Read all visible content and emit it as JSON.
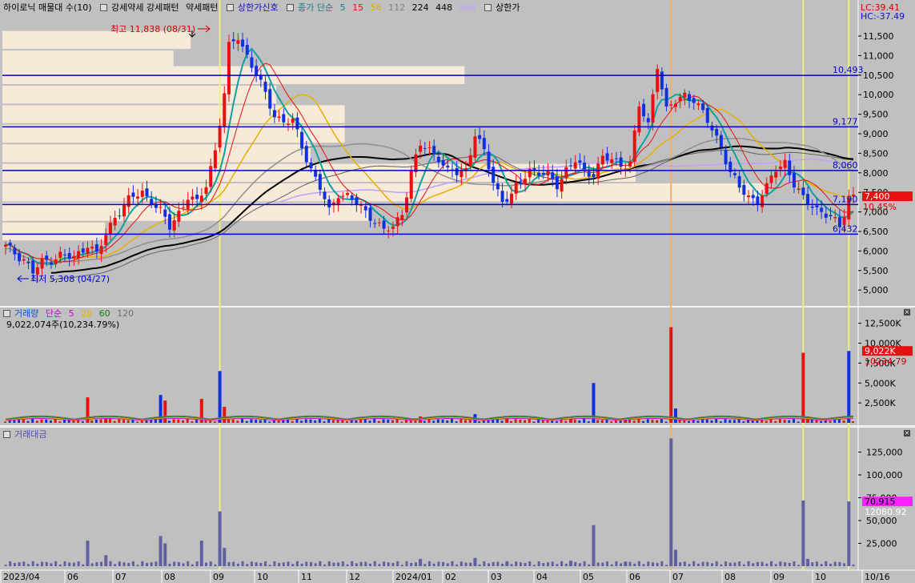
{
  "header": {
    "title": "하이로닉 매물대 수(10)",
    "pattern_strong_weak": "강세약세 강세패턴",
    "pattern_weak": "약세패턴",
    "upper_signal": "상한가신호",
    "ma_label": "종가 단순",
    "ma_periods": [
      "5",
      "15",
      "56",
      "112",
      "224",
      "448",
      "960"
    ],
    "upper_price": "상한가",
    "lc": "LC:39.41",
    "hc": "HC:-37.49"
  },
  "price_axis": {
    "ticks": [
      "11,500",
      "11,000",
      "10,500",
      "10,000",
      "9,500",
      "9,000",
      "8,500",
      "8,000",
      "7,500",
      "7,000",
      "6,500",
      "6,000",
      "5,500",
      "5,000"
    ],
    "current_price": "7,400",
    "current_change": "10.45%"
  },
  "annotations": {
    "high": "최고 11,838 (08/31)",
    "low": "최저 5,308 (04/27)",
    "levels": [
      "10,493",
      "9,177",
      "8,060",
      "7,190",
      "6,432"
    ]
  },
  "volume_pane": {
    "title": "거래량",
    "ma_label": "단순",
    "ma_periods": [
      "5",
      "20",
      "60",
      "120"
    ],
    "current_value": "9,022,074주(10,234.79%)",
    "ticks": [
      "12,500K",
      "10,000K",
      "7,500K",
      "5,000K",
      "2,500K"
    ],
    "tag_value": "9,022K",
    "tag_ratio": "10234.79"
  },
  "amount_pane": {
    "title": "거래대금",
    "ticks": [
      "125,000",
      "100,000",
      "75,000",
      "50,000",
      "25,000"
    ],
    "tag_value": "70,915",
    "tag_ratio": "12080.92"
  },
  "x_axis": {
    "labels": [
      "2023/04",
      "06",
      "07",
      "08",
      "09",
      "10",
      "11",
      "12",
      "2024/01",
      "02",
      "03",
      "04",
      "05",
      "06",
      "07",
      "08",
      "09",
      "10",
      "10/16"
    ]
  },
  "colors": {
    "up": "#e81010",
    "down": "#1030e0",
    "ma5": "#e81010",
    "ma15": "#10a0a0",
    "ma56": "#e8b000",
    "ma112": "#909090",
    "ma224": "#000000",
    "ma448": "#606060",
    "ma960": "#c0a0ff",
    "level_line": "#0000c8",
    "profile": "#f7ead8",
    "amount_bar": "#6060a0",
    "tag_red": "#e81010",
    "tag_magenta": "#ff20ff"
  },
  "chart_data": {
    "type": "candlestick",
    "x_range": [
      "2023-04",
      "2024-10-16"
    ],
    "ylim": [
      4600,
      12000
    ],
    "price_path": [
      [
        0,
        6100
      ],
      [
        4,
        5800
      ],
      [
        6,
        5450
      ],
      [
        8,
        5700
      ],
      [
        12,
        5900
      ],
      [
        15,
        5800
      ],
      [
        18,
        6200
      ],
      [
        20,
        5900
      ],
      [
        24,
        6900
      ],
      [
        27,
        7300
      ],
      [
        30,
        7500
      ],
      [
        32,
        7300
      ],
      [
        34,
        7000
      ],
      [
        36,
        6600
      ],
      [
        38,
        7000
      ],
      [
        40,
        7400
      ],
      [
        42,
        7200
      ],
      [
        44,
        7700
      ],
      [
        46,
        8600
      ],
      [
        48,
        10000
      ],
      [
        49,
        11200
      ],
      [
        51,
        11500
      ],
      [
        53,
        11000
      ],
      [
        55,
        10500
      ],
      [
        57,
        10000
      ],
      [
        59,
        9500
      ],
      [
        61,
        9300
      ],
      [
        63,
        9300
      ],
      [
        65,
        8700
      ],
      [
        67,
        8100
      ],
      [
        69,
        7600
      ],
      [
        71,
        7000
      ],
      [
        73,
        7500
      ],
      [
        75,
        7400
      ],
      [
        77,
        7200
      ],
      [
        79,
        7000
      ],
      [
        81,
        6800
      ],
      [
        83,
        6500
      ],
      [
        85,
        6600
      ],
      [
        87,
        7000
      ],
      [
        89,
        8000
      ],
      [
        91,
        8700
      ],
      [
        93,
        8600
      ],
      [
        95,
        8400
      ],
      [
        97,
        8000
      ],
      [
        99,
        8000
      ],
      [
        101,
        8100
      ],
      [
        103,
        9000
      ],
      [
        105,
        8500
      ],
      [
        107,
        7800
      ],
      [
        109,
        7300
      ],
      [
        111,
        7400
      ],
      [
        113,
        7800
      ],
      [
        115,
        8100
      ],
      [
        117,
        8000
      ],
      [
        119,
        7900
      ],
      [
        121,
        7700
      ],
      [
        123,
        8100
      ],
      [
        125,
        8300
      ],
      [
        127,
        8000
      ],
      [
        129,
        8000
      ],
      [
        131,
        8400
      ],
      [
        133,
        8300
      ],
      [
        135,
        8200
      ],
      [
        137,
        8300
      ],
      [
        139,
        9700
      ],
      [
        141,
        9200
      ],
      [
        143,
        10800
      ],
      [
        145,
        9600
      ],
      [
        147,
        9800
      ],
      [
        149,
        10000
      ],
      [
        151,
        9900
      ],
      [
        153,
        9500
      ],
      [
        155,
        9100
      ],
      [
        157,
        8700
      ],
      [
        159,
        8000
      ],
      [
        161,
        7600
      ],
      [
        163,
        7400
      ],
      [
        165,
        7300
      ],
      [
        167,
        7600
      ],
      [
        169,
        8100
      ],
      [
        171,
        8300
      ],
      [
        173,
        7700
      ],
      [
        175,
        7300
      ],
      [
        177,
        7200
      ],
      [
        179,
        7000
      ],
      [
        181,
        6850
      ],
      [
        183,
        6600
      ],
      [
        185,
        7400
      ]
    ],
    "volume_spikes": [
      [
        18,
        3200
      ],
      [
        22,
        700
      ],
      [
        34,
        3500
      ],
      [
        35,
        2800
      ],
      [
        43,
        3000
      ],
      [
        47,
        6500
      ],
      [
        48,
        2000
      ],
      [
        91,
        800
      ],
      [
        103,
        1100
      ],
      [
        110,
        600
      ],
      [
        124,
        500
      ],
      [
        129,
        5000
      ],
      [
        136,
        600
      ],
      [
        146,
        15500
      ],
      [
        147,
        1800
      ],
      [
        175,
        8800
      ],
      [
        176,
        800
      ],
      [
        185,
        9020
      ]
    ],
    "amount_spikes": [
      [
        18,
        28000
      ],
      [
        22,
        12000
      ],
      [
        34,
        33000
      ],
      [
        35,
        25000
      ],
      [
        43,
        28000
      ],
      [
        47,
        60000
      ],
      [
        48,
        20000
      ],
      [
        91,
        8000
      ],
      [
        103,
        9000
      ],
      [
        110,
        5000
      ],
      [
        124,
        6000
      ],
      [
        129,
        45000
      ],
      [
        136,
        5000
      ],
      [
        146,
        140000
      ],
      [
        147,
        18000
      ],
      [
        175,
        72000
      ],
      [
        176,
        8000
      ],
      [
        185,
        70915
      ]
    ],
    "volume_profile": [
      [
        11400,
        0.22
      ],
      [
        10900,
        0.2
      ],
      [
        10500,
        0.54
      ],
      [
        10000,
        0.32
      ],
      [
        9500,
        0.4
      ],
      [
        9000,
        0.4
      ],
      [
        8500,
        0.36
      ],
      [
        8000,
        0.74
      ],
      [
        7500,
        0.89
      ],
      [
        7000,
        0.43
      ],
      [
        6500,
        0.12
      ]
    ],
    "levels": [
      10493,
      9177,
      8060,
      7190,
      6432
    ]
  }
}
